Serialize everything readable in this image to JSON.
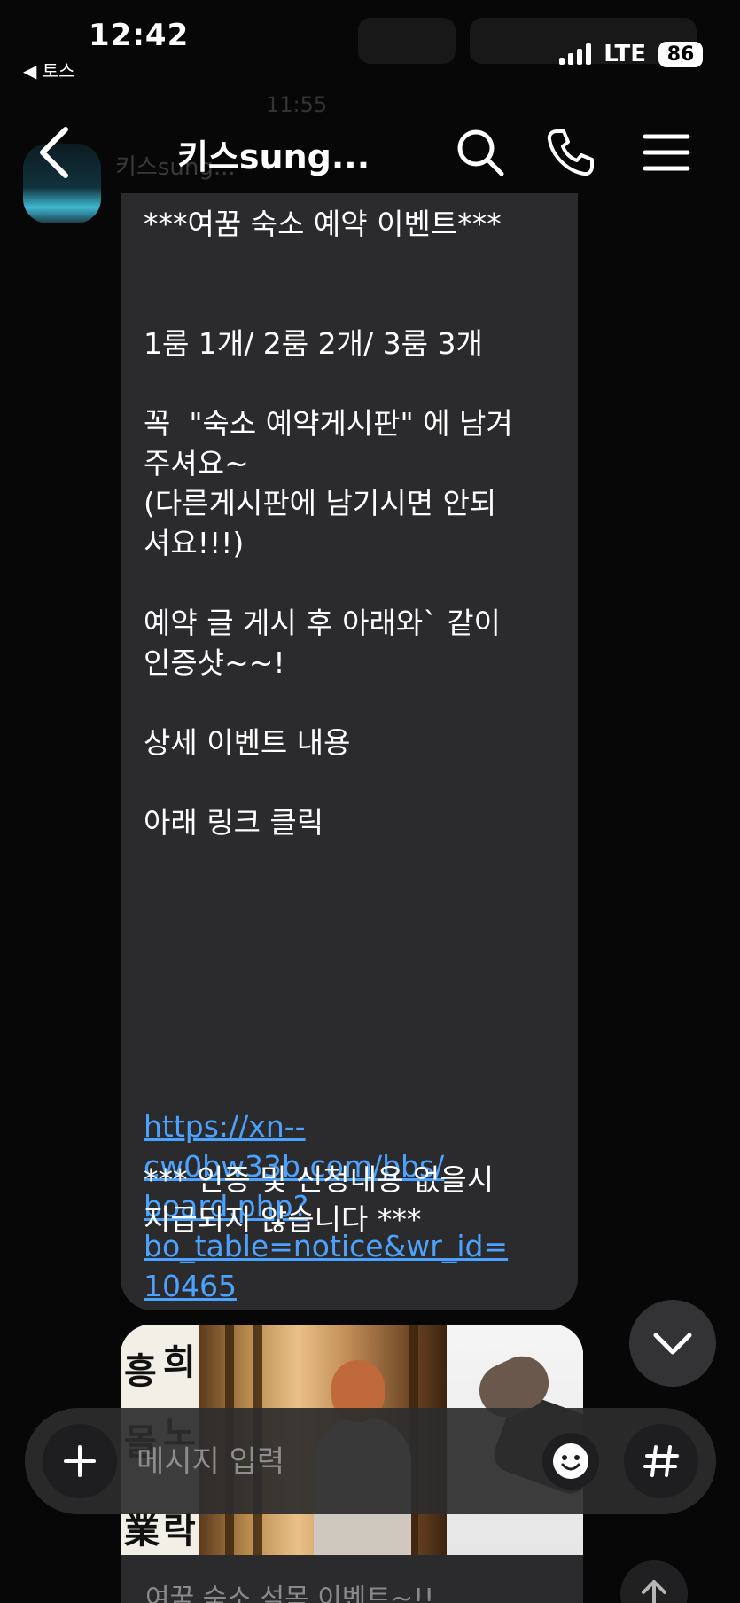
{
  "status_bar": {
    "time": "12:42",
    "back_app": "◀ 토스",
    "network": "LTE",
    "battery": "86"
  },
  "background": {
    "timestamp": "11:55"
  },
  "header": {
    "title": "키스sung...",
    "icons": [
      "back-icon",
      "search-icon",
      "phone-icon",
      "menu-icon"
    ]
  },
  "message": {
    "sender": "키스sung...",
    "body": "***여꿈 숙소 예약 이벤트***\n\n\n1룸 1개/ 2룸 2개/ 3룸 3개\n\n꼭  \"숙소 예약게시판\" 에 남겨\n주셔요~\n(다른게시판에 남기시면 안되\n셔요!!!)\n\n예약 글 게시 후 아래와` 같이\n인증샷~~!\n\n상세 이벤트 내용\n\n아래 링크 클릭",
    "link": "https://xn--cw0bw33b.com/bbs/board.php?bo_table=notice&wr_id=10465",
    "link_display": "https://xn--\ncw0bw33b.com/bbs/\nboard.php?\nbo_table=notice&wr_id=\n10465",
    "footer": "*** 인증 및 신청내용 없을시\n지급되지 않습니다 ***"
  },
  "image_card": {
    "calligraphy": [
      "흥",
      "희",
      "몰",
      "노",
      "業",
      "락"
    ],
    "caption": "여꿈 숙소 석목 이벤트~!!"
  },
  "input": {
    "placeholder": "메시지 입력"
  },
  "colors": {
    "background": "#070707",
    "bubble": "#2b2b2d",
    "link": "#4ba3ff",
    "input_bar": "#2c2c2e"
  }
}
